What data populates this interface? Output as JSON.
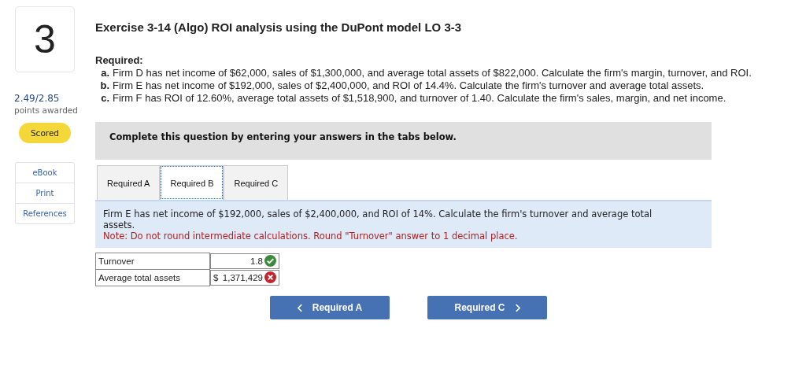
{
  "question": {
    "number": "3",
    "score": "2.49/2.85",
    "score_label": "points awarded",
    "status": "Scored"
  },
  "side_links": [
    "eBook",
    "Print",
    "References"
  ],
  "title": "Exercise 3-14 (Algo) ROI analysis using the DuPont model LO 3-3",
  "required": {
    "heading": "Required:",
    "items": [
      {
        "letter": "a.",
        "text": "Firm D has net income of $62,000, sales of $1,300,000, and average total assets of $822,000. Calculate the firm's margin, turnover, and ROI."
      },
      {
        "letter": "b.",
        "text": "Firm E has net income of $192,000, sales of $2,400,000, and ROI of 14.4%. Calculate the firm's turnover and average total assets."
      },
      {
        "letter": "c.",
        "text": "Firm F has ROI of 12.60%, average total assets of $1,518,900, and turnover of 1.40. Calculate the firm's sales, margin, and net income."
      }
    ]
  },
  "instruction": "Complete this question by entering your answers in the tabs below.",
  "tabs": [
    {
      "label": "Required A",
      "selected": false
    },
    {
      "label": "Required B",
      "selected": true
    },
    {
      "label": "Required C",
      "selected": false
    }
  ],
  "panel": {
    "text": "Firm E has net income of $192,000, sales of $2,400,000, and ROI of 14%. Calculate the firm's turnover and average total assets.",
    "note": "Note: Do not round intermediate calculations. Round \"Turnover\" answer to 1 decimal place."
  },
  "answers": [
    {
      "label": "Turnover",
      "value": "1.8",
      "correct": true
    },
    {
      "label": "Average total assets",
      "prefix": "$",
      "value": "1,371,429",
      "correct": false
    }
  ],
  "nav": {
    "prev": "Required A",
    "next": "Required C"
  }
}
